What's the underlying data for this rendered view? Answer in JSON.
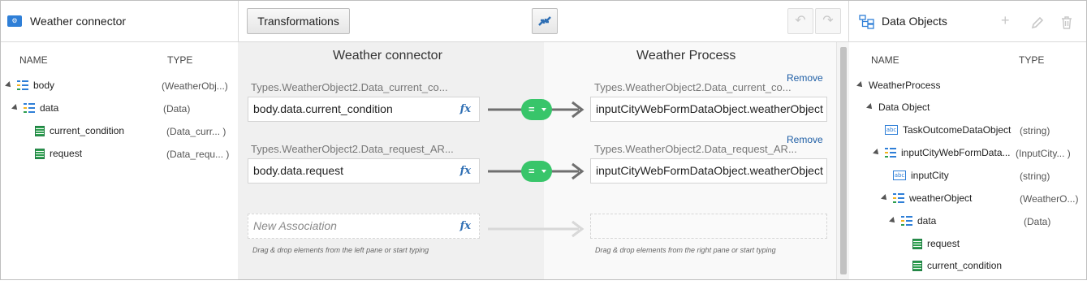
{
  "left": {
    "title": "Weather connector",
    "col_name": "NAME",
    "col_type": "TYPE",
    "items": [
      {
        "label": "body",
        "type": "(WeatherObj...)"
      },
      {
        "label": "data",
        "type": "(Data)"
      },
      {
        "label": "current_condition",
        "type": "(Data_curr...  )"
      },
      {
        "label": "request",
        "type": "(Data_requ...  )"
      }
    ]
  },
  "toolbar": {
    "transformations_label": "Transformations",
    "undo_glyph": "↶",
    "redo_glyph": "↷"
  },
  "mapping": {
    "source_title": "Weather connector",
    "target_title": "Weather Process",
    "rows": [
      {
        "source_path": "Types.WeatherObject2.Data_current_co...",
        "source_value": "body.data.current_condition",
        "target_path": "Types.WeatherObject2.Data_current_co...",
        "target_value": "inputCityWebFormDataObject.weatherObject",
        "remove_label": "Remove",
        "operator": "="
      },
      {
        "source_path": "Types.WeatherObject2.Data_request_AR...",
        "source_value": "body.data.request",
        "target_path": "Types.WeatherObject2.Data_request_AR...",
        "target_value": "inputCityWebFormDataObject.weatherObject",
        "remove_label": "Remove",
        "operator": "="
      }
    ],
    "new_association_placeholder": "New Association",
    "fx_label": "fx",
    "left_hint": "Drag & drop elements from the left pane or start typing",
    "right_hint": "Drag & drop elements from the right pane or start typing"
  },
  "right": {
    "title": "Data Objects",
    "col_name": "NAME",
    "col_type": "TYPE",
    "items": [
      {
        "label": "WeatherProcess",
        "type": ""
      },
      {
        "label": "Data Object",
        "type": ""
      },
      {
        "label": "TaskOutcomeDataObject",
        "type": "(string)"
      },
      {
        "label": "inputCityWebFormData...",
        "type": "(InputCity...    )"
      },
      {
        "label": "inputCity",
        "type": "(string)"
      },
      {
        "label": "weatherObject",
        "type": "(WeatherO...)"
      },
      {
        "label": "data",
        "type": "(Data)"
      },
      {
        "label": "request",
        "type": ""
      },
      {
        "label": "current_condition",
        "type": ""
      }
    ],
    "icons": [
      "plus-icon",
      "pencil-icon",
      "trash-icon"
    ]
  },
  "colors": {
    "accent": "#2f7fd7",
    "link": "#1f5fa6",
    "operator_green": "#38c56a"
  }
}
